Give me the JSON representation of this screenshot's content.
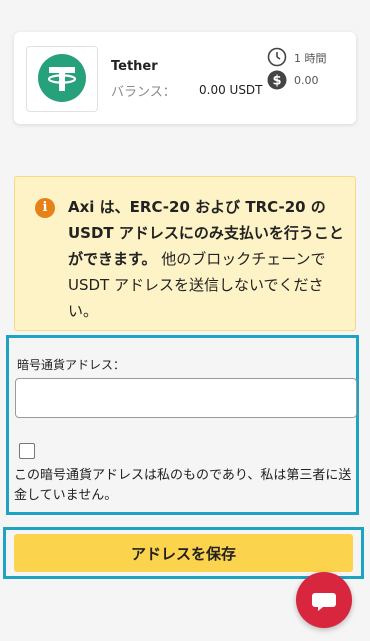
{
  "wallet": {
    "coin_name": "Tether",
    "balance_label": "バランス：",
    "balance_value": "0.00 USDT",
    "time_value": "1 時間",
    "fee_value": "0.00",
    "logo_icon": "tether-logo-icon",
    "brand_color": "#26a17b"
  },
  "notice": {
    "bold_text": "Axi は、ERC-20 および TRC-20 の USDT アドレスにのみ支払いを行うことができます。",
    "normal_text": " 他のブロックチェーンで USDT アドレスを送信しないでください。",
    "icon": "info-icon",
    "icon_glyph": "i"
  },
  "form": {
    "address_label": "暗号通貨アドレス：",
    "address_value": "",
    "confirm_text": "この暗号通貨アドレスは私のものであり、私は第三者に送金していません。",
    "confirm_checked": false
  },
  "actions": {
    "save_label": "アドレスを保存"
  },
  "colors": {
    "accent_button": "#fcd34d",
    "notice_bg": "#fdf3c7",
    "chat_button": "#d7263d",
    "highlight": "#1ea3c2"
  }
}
